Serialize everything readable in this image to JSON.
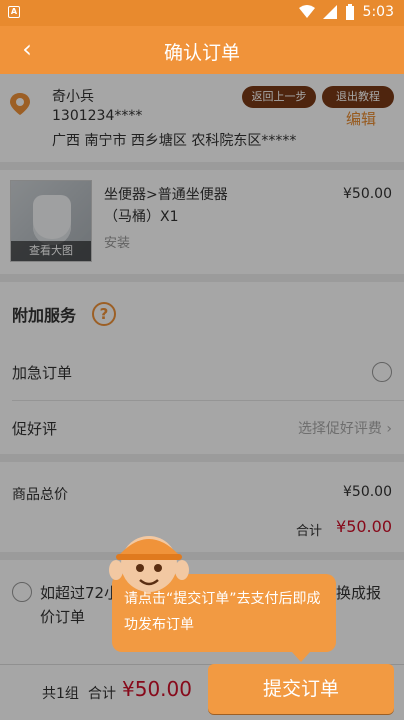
{
  "status": {
    "left_icon": "A",
    "time": "5:03",
    "icons": [
      "wifi-icon",
      "signal-icon",
      "battery-icon"
    ]
  },
  "appbar": {
    "back_icon": "‹",
    "title": "确认订单"
  },
  "address": {
    "name": "奇小兵",
    "phone": "1301234****",
    "detail": "广西 南宁市 西乡塘区 农科院东区*****",
    "btn_back": "返回上一步",
    "btn_exit": "退出教程",
    "edit": "编辑"
  },
  "product": {
    "name": "坐便器>普通坐便器",
    "qty": "（马桶）X1",
    "sub": "安装",
    "price": "¥50.00",
    "thumb_caption": "查看大图"
  },
  "services": {
    "header": "附加服务",
    "help_icon": "?",
    "urgent": "加急订单",
    "review": "促好评",
    "review_hint": "选择促好评费 ›"
  },
  "totals": {
    "label": "商品总价",
    "value": "¥50.00",
    "sum_label": "合计",
    "sum_value": "¥50.00"
  },
  "policy": {
    "line1": "如超过72小",
    "line2": "价订单",
    "line1_end": "换成报"
  },
  "bottombar": {
    "count": "共1组",
    "label": "合计",
    "amount": "¥50.00",
    "submit": "提交订单"
  },
  "tip": {
    "text": "请点击“提交订单”去支付后即成功发布订单"
  },
  "colors": {
    "accent": "#f0933a",
    "price_red": "#d0102a",
    "brown": "#7a3a16"
  }
}
